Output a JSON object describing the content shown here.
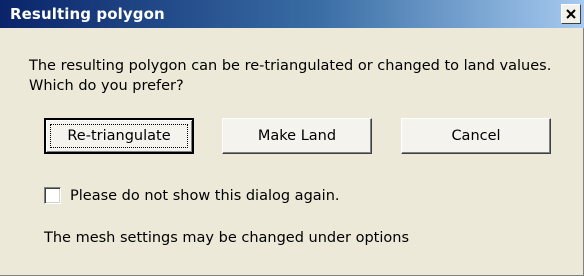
{
  "window": {
    "title": "Resulting polygon"
  },
  "message": {
    "line1": "The resulting polygon can be re-triangulated or changed to land values.",
    "line2": "Which do you prefer?"
  },
  "buttons": {
    "retriangulate_label": "Re-triangulate",
    "make_land_label": "Make Land",
    "cancel_label": "Cancel"
  },
  "checkbox": {
    "label": "Please do not show this dialog again.",
    "checked": false
  },
  "note": {
    "text": "The mesh settings may be changed under options"
  },
  "colors": {
    "dialog_bg": "#ece9d8",
    "titlebar_start": "#0a246a",
    "titlebar_end": "#a6caf0",
    "title_text": "#ffffff"
  },
  "icons": {
    "close": "close-icon"
  }
}
